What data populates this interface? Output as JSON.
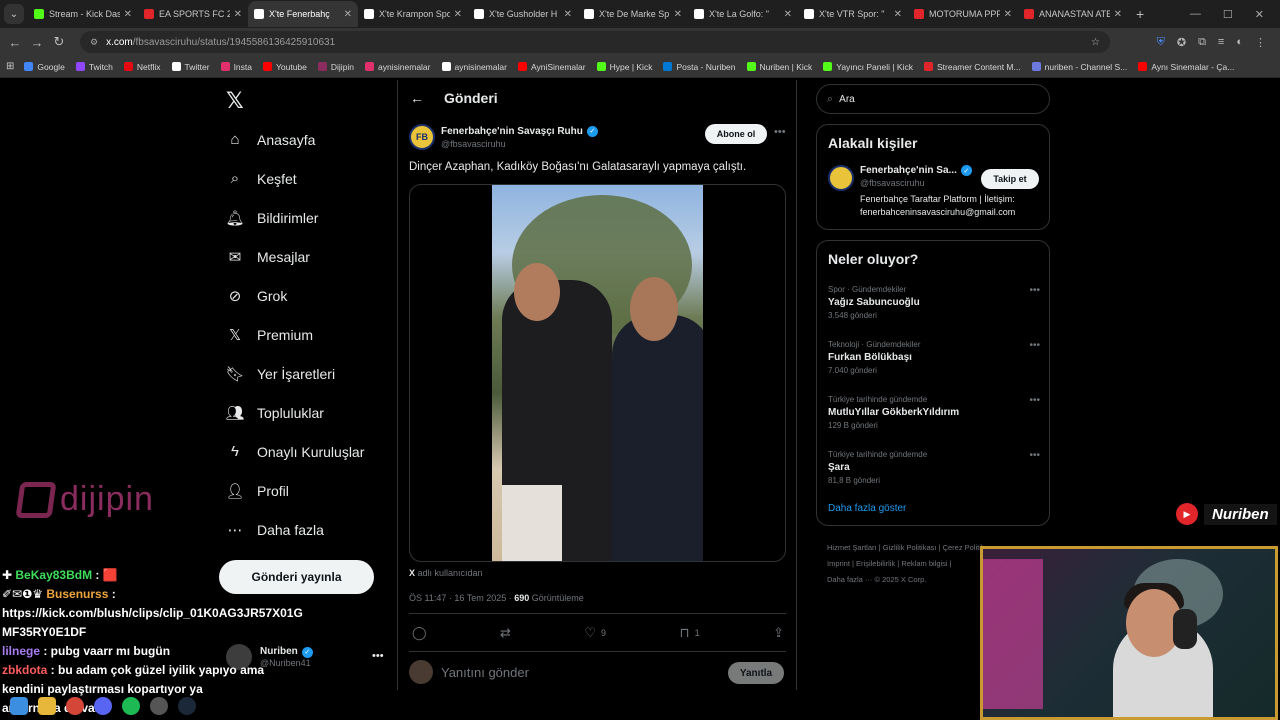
{
  "browser": {
    "tabs": [
      {
        "label": "Stream - Kick Das",
        "color": "#53fc18"
      },
      {
        "label": "EA SPORTS FC 26",
        "color": "#e0252b"
      },
      {
        "label": "X'te Fenerbahç",
        "color": "#ffffff",
        "active": true
      },
      {
        "label": "X'te Krampon Spo",
        "color": "#ffffff"
      },
      {
        "label": "X'te Gusholder H",
        "color": "#ffffff"
      },
      {
        "label": "X'te De Marke Sp",
        "color": "#ffffff"
      },
      {
        "label": "X'te La Golfo: \"",
        "color": "#ffffff"
      },
      {
        "label": "X'te VTR Spor: \"",
        "color": "#ffffff"
      },
      {
        "label": "MOTORUMA PPF",
        "color": "#e0252b"
      },
      {
        "label": "ANANASTAN ATE",
        "color": "#e0252b"
      }
    ],
    "url_host": "x.com",
    "url_path": "/fbsavasciruhu/status/1945586136425910631",
    "bookmarks": [
      {
        "label": "Google",
        "color": "#4285f4"
      },
      {
        "label": "Twitch",
        "color": "#9146ff"
      },
      {
        "label": "Netflix",
        "color": "#e50914"
      },
      {
        "label": "Twitter",
        "color": "#ffffff"
      },
      {
        "label": "Insta",
        "color": "#e1306c"
      },
      {
        "label": "Youtube",
        "color": "#ff0000"
      },
      {
        "label": "Dijipin",
        "color": "#8a2d5e"
      },
      {
        "label": "aynisinemalar",
        "color": "#e1306c"
      },
      {
        "label": "aynisinemalar",
        "color": "#ffffff"
      },
      {
        "label": "AyniSinemalar",
        "color": "#ff0000"
      },
      {
        "label": "Hype | Kick",
        "color": "#53fc18"
      },
      {
        "label": "Posta - Nuriben",
        "color": "#0078d4"
      },
      {
        "label": "Nuriben | Kick",
        "color": "#53fc18"
      },
      {
        "label": "Yayıncı Paneli | Kick",
        "color": "#53fc18"
      },
      {
        "label": "Streamer Content M...",
        "color": "#e0252b"
      },
      {
        "label": "nuriben - Channel S...",
        "color": "#6c7ae0"
      },
      {
        "label": "Aynı Sinemalar - Ça...",
        "color": "#ff0000"
      }
    ]
  },
  "nav": {
    "logo": "𝕏",
    "items": [
      {
        "label": "Anasayfa",
        "icon": "⌂",
        "name": "home"
      },
      {
        "label": "Keşfet",
        "icon": "⌕",
        "name": "explore"
      },
      {
        "label": "Bildirimler",
        "icon": "🔔︎",
        "name": "notifications"
      },
      {
        "label": "Mesajlar",
        "icon": "✉",
        "name": "messages"
      },
      {
        "label": "Grok",
        "icon": "⊘",
        "name": "grok"
      },
      {
        "label": "Premium",
        "icon": "𝕏",
        "name": "premium"
      },
      {
        "label": "Yer İşaretleri",
        "icon": "🔖︎",
        "name": "bookmarks"
      },
      {
        "label": "Topluluklar",
        "icon": "👥︎",
        "name": "communities"
      },
      {
        "label": "Onaylı Kuruluşlar",
        "icon": "ϟ",
        "name": "verified-orgs"
      },
      {
        "label": "Profil",
        "icon": "👤︎",
        "name": "profile"
      },
      {
        "label": "Daha fazla",
        "icon": "⋯",
        "name": "more"
      }
    ],
    "post_button": "Gönderi yayınla",
    "me_name": "Nuriben",
    "me_handle": "@Nuriben41"
  },
  "post": {
    "header": "Gönderi",
    "author_name": "Fenerbahçe'nin Savaşçı Ruhu",
    "author_handle": "@fbsavasciruhu",
    "subscribe": "Abone ol",
    "text": "Dinçer Azaphan, Kadıköy Boğası'nı Galatasaraylı yapmaya çalıştı.",
    "source_prefix": "X",
    "source_text": " adlı kullanıcıdan",
    "time": "ÖS 11:47 · 16 Tem 2025 · ",
    "views": "690",
    "views_label": " Görüntüleme",
    "likes": "9",
    "bookmarks": "1",
    "reply_placeholder": "Yanıtını gönder",
    "reply_button": "Yanıtla"
  },
  "right": {
    "search_placeholder": "Ara",
    "related_title": "Alakalı kişiler",
    "related_name": "Fenerbahçe'nin Sa...",
    "related_handle": "@fbsavasciruhu",
    "related_bio": "Fenerbahçe Taraftar Platform | İletişim: fenerbahceninsavasciruhu@gmail.com",
    "follow": "Takip et",
    "trends_title": "Neler oluyor?",
    "trends": [
      {
        "cat": "Spor · Gündemdekiler",
        "name": "Yağız Sabuncuoğlu",
        "count": "3.548 gönderi"
      },
      {
        "cat": "Teknoloji · Gündemdekiler",
        "name": "Furkan Bölükbaşı",
        "count": "7.040 gönderi"
      },
      {
        "cat": "Türkiye tarihinde gündemde",
        "name": "MutluYıllar GökberkYıldırım",
        "count": "129 B gönderi"
      },
      {
        "cat": "Türkiye tarihinde gündemde",
        "name": "Şara",
        "count": "81,8 B gönderi"
      }
    ],
    "show_more": "Daha fazla göster",
    "footer_line1": "Hizmet Şartları  |  Gizlilik Politikası  |  Çerez Politikası",
    "footer_line2": "Imprint  |  Erişilebilirlik  |  Reklam bilgisi  |",
    "footer_line3": "Daha fazla ···   © 2025 X Corp."
  },
  "overlay": {
    "dijipin": "dijipin",
    "chat": [
      {
        "user": "BeKay83BdM",
        "prefix": "✚ ",
        "msg": " : 🟥",
        "cls": "u1"
      },
      {
        "user": "Busenurss",
        "prefix": "✐✉❶♛ ",
        "msg": " :",
        "cls": "u2"
      },
      {
        "user": "",
        "prefix": "",
        "msg": "https://kick.com/blush/clips/clip_01K0AG3JR57X01G MF35RY0E1DF",
        "cls": ""
      },
      {
        "user": "lilnege",
        "prefix": "",
        "msg": " : pubg vaarr mı bugün",
        "cls": "u3"
      },
      {
        "user": "zbkdota",
        "prefix": "",
        "msg": " : bu adam çok güzel iyilik yapıyo ama kendini paylaştırması kopartıyor ya",
        "cls": "u4"
      },
      {
        "user": "",
        "prefix": "",
        "msg": "ar turnuva da var",
        "cls": ""
      }
    ],
    "badge": "Nuriben"
  }
}
